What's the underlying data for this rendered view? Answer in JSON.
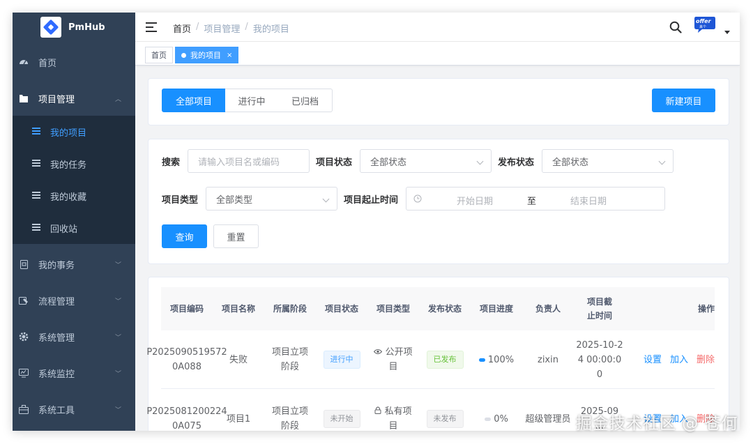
{
  "brand": {
    "name": "PmHub",
    "color": "#2f6bff"
  },
  "colors": {
    "sidebar_bg": "#304156",
    "submenu_bg": "#1f2d3d",
    "primary": "#1890ff",
    "danger": "#f56c6c"
  },
  "sidebar": {
    "items": [
      {
        "label": "首页",
        "icon": "dashboard-icon"
      },
      {
        "label": "项目管理",
        "icon": "folder-icon",
        "expanded": true
      },
      {
        "label": "我的事务",
        "icon": "affairs-icon"
      },
      {
        "label": "流程管理",
        "icon": "workflow-icon"
      },
      {
        "label": "系统管理",
        "icon": "gear-icon"
      },
      {
        "label": "系统监控",
        "icon": "monitor-icon"
      },
      {
        "label": "系统工具",
        "icon": "toolbox-icon"
      }
    ],
    "submenu": [
      {
        "label": "我的项目",
        "active": true
      },
      {
        "label": "我的任务"
      },
      {
        "label": "我的收藏"
      },
      {
        "label": "回收站"
      }
    ]
  },
  "header": {
    "breadcrumb": [
      "首页",
      "项目管理",
      "我的项目"
    ],
    "separator": "/",
    "avatar_text": "offer",
    "avatar_sub": "来个"
  },
  "tags": [
    {
      "label": "首页",
      "active": false
    },
    {
      "label": "我的项目",
      "active": true,
      "close": "×"
    }
  ],
  "filter_tabs": [
    "全部项目",
    "进行中",
    "已归档"
  ],
  "new_button": "新建项目",
  "search_form": {
    "search_label": "搜索",
    "search_placeholder": "请输入项目名或编码",
    "status_label": "项目状态",
    "status_value": "全部状态",
    "publish_label": "发布状态",
    "publish_value": "全部状态",
    "type_label": "项目类型",
    "type_value": "全部类型",
    "date_label": "项目起止时间",
    "date_start": "开始日期",
    "date_sep": "至",
    "date_end": "结束日期",
    "query_button": "查询",
    "reset_button": "重置"
  },
  "table": {
    "columns": [
      "项目编码",
      "项目名称",
      "所属阶段",
      "项目状态",
      "项目类型",
      "发布状态",
      "项目进度",
      "负责人",
      "项目截止时间",
      "操作"
    ],
    "rows": [
      {
        "code": "P2025090519572 0A088",
        "name": "失败",
        "stage": "项目立项阶段",
        "status": "进行中",
        "type": "公开项目",
        "type_icon": "eye-icon",
        "publish": "已发布",
        "progress": "100%",
        "progress_value": 100,
        "owner": "zixin",
        "deadline": "2025-10-24 00:00:00",
        "actions": [
          "设置",
          "加入",
          "删除"
        ]
      },
      {
        "code": "P2025081200224 0A075",
        "name": "项目1",
        "stage": "项目立项阶段",
        "status": "未开始",
        "type": "私有项目",
        "type_icon": "lock-icon",
        "publish": "未发布",
        "progress": "0%",
        "progress_value": 0,
        "owner": "超级管理员",
        "deadline": "2025-09 ...",
        "actions": [
          "设置",
          "加入",
          "删除"
        ]
      }
    ]
  },
  "watermark": "掘金技术社区 @ 苍何"
}
